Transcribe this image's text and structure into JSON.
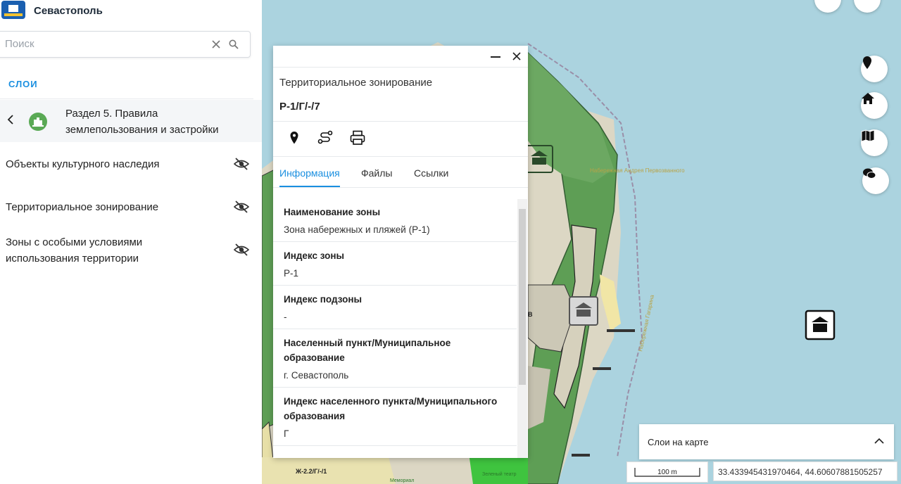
{
  "app": {
    "title": "Севастополь"
  },
  "search": {
    "placeholder": "Поиск"
  },
  "sidebar": {
    "tab_label": "СЛОИ",
    "section_label": "Раздел 5. Правила землепользования и застройки",
    "layers": [
      {
        "label": "Объекты культурного наследия"
      },
      {
        "label": "Территориальное зонирование"
      },
      {
        "label": "Зоны с особыми условиями использования территории"
      }
    ]
  },
  "popup": {
    "title": "Территориальное зонирование",
    "code": "Р-1/Г/-/7",
    "tabs": [
      {
        "label": "Информация"
      },
      {
        "label": "Файлы"
      },
      {
        "label": "Ссылки"
      }
    ],
    "fields": [
      {
        "label": "Наименование зоны",
        "value": "Зона набережных и пляжей (Р-1)"
      },
      {
        "label": "Индекс зоны",
        "value": "Р-1"
      },
      {
        "label": "Индекс подзоны",
        "value": "-"
      },
      {
        "label": "Населенный пункт/Муниципальное образование",
        "value": "г. Севастополь"
      },
      {
        "label": "Индекс населенного пункта/Муниципального образования",
        "value": "Г"
      }
    ]
  },
  "map": {
    "labels": {
      "embankment": "Набережная Андрея Первозванного",
      "zone_code": "Ж-2.2/Г/-/1",
      "green_theatre": "Зеленый театр",
      "memorial": "Мемориал",
      "street": "Набережная Гагарина",
      "letter": "В"
    },
    "layers_panel_label": "Слои на карте",
    "scale_label": "100 m",
    "coordinates": "33.433945431970464, 44.60607881505257",
    "colors": {
      "water": "#abd3df",
      "park_dark": "#5b9a56",
      "park_green": "#3fc43f",
      "sand": "#e7dfa7",
      "land": "#dcd7c4"
    }
  }
}
